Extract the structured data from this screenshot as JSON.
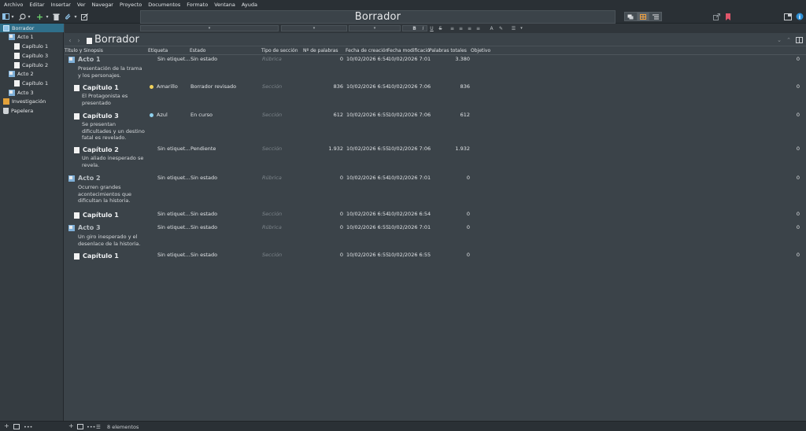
{
  "menu": [
    "Archivo",
    "Editar",
    "Insertar",
    "Ver",
    "Navegar",
    "Proyecto",
    "Documentos",
    "Formato",
    "Ventana",
    "Ayuda"
  ],
  "toolbar": {
    "title": "Borrador"
  },
  "binder": [
    {
      "label": "Borrador",
      "type": "draft",
      "level": 0,
      "selected": true
    },
    {
      "label": "Acto 1",
      "type": "folder",
      "level": 1
    },
    {
      "label": "Capítulo 1",
      "type": "doc",
      "level": 2
    },
    {
      "label": "Capítulo 3",
      "type": "doc",
      "level": 2
    },
    {
      "label": "Capítulo 2",
      "type": "doc",
      "level": 2
    },
    {
      "label": "Acto 2",
      "type": "folder",
      "level": 1
    },
    {
      "label": "Capítulo 1",
      "type": "doc",
      "level": 2
    },
    {
      "label": "Acto 3",
      "type": "folder",
      "level": 1
    },
    {
      "label": "Investigación",
      "type": "research",
      "level": 0
    },
    {
      "label": "Papelera",
      "type": "trash",
      "level": 0
    }
  ],
  "editor": {
    "doc_title": "Borrador"
  },
  "columns": {
    "title": "Título y Sinopsis",
    "label": "Etiqueta",
    "status": "Estado",
    "section": "Tipo de sección",
    "words": "Nº de palabras",
    "created": "Fecha de creación",
    "modified": "Fecha modificació",
    "total": "Palabras totales",
    "target": "Objetivo"
  },
  "rows": [
    {
      "title": "Acto 1",
      "synopsis": "Presentación de la trama y los personajes.",
      "kind": "folder",
      "label": "Sin etiquet...",
      "label_color": "",
      "status": "Sin estado",
      "section": "Rúbrica",
      "words": "0",
      "created": "10/02/2026 6:54",
      "modified": "10/02/2026 7:01",
      "total": "3.380",
      "target": "0"
    },
    {
      "title": "Capítulo 1",
      "synopsis": "El Protagonista es presentado",
      "kind": "doc",
      "label": "Amarillo",
      "label_color": "#f2d25c",
      "status": "Borrador revisado",
      "section": "Sección",
      "words": "836",
      "created": "10/02/2026 6:54",
      "modified": "10/02/2026 7:06",
      "total": "836",
      "target": "0"
    },
    {
      "title": "Capítulo 3",
      "synopsis": "Se presentan dificultades y un destino fatal es revelado.",
      "kind": "doc",
      "label": "Azul",
      "label_color": "#8fd1ee",
      "status": "En curso",
      "section": "Sección",
      "words": "612",
      "created": "10/02/2026 6:55",
      "modified": "10/02/2026 7:06",
      "total": "612",
      "target": "0"
    },
    {
      "title": "Capítulo 2",
      "synopsis": "Un aliado inesperado se revela.",
      "kind": "doc",
      "label": "Sin etiquet...",
      "label_color": "",
      "status": "Pendiente",
      "section": "Sección",
      "words": "1.932",
      "created": "10/02/2026 6:55",
      "modified": "10/02/2026 7:06",
      "total": "1.932",
      "target": "0"
    },
    {
      "title": "Acto 2",
      "synopsis": "Ocurren grandes acontecimientos que dificultan la historia.",
      "kind": "folder",
      "label": "Sin etiquet...",
      "label_color": "",
      "status": "Sin estado",
      "section": "Rúbrica",
      "words": "0",
      "created": "10/02/2026 6:54",
      "modified": "10/02/2026 7:01",
      "total": "0",
      "target": "0"
    },
    {
      "title": "Capítulo 1",
      "synopsis": "",
      "kind": "doc",
      "label": "Sin etiquet...",
      "label_color": "",
      "status": "Sin estado",
      "section": "Sección",
      "words": "0",
      "created": "10/02/2026 6:54",
      "modified": "10/02/2026 6:54",
      "total": "0",
      "target": "0"
    },
    {
      "title": "Acto 3",
      "synopsis": "Un giro inesperado y el desenlace de la historia.",
      "kind": "folder",
      "label": "Sin etiquet...",
      "label_color": "",
      "status": "Sin estado",
      "section": "Rúbrica",
      "words": "0",
      "created": "10/02/2026 6:55",
      "modified": "10/02/2026 7:01",
      "total": "0",
      "target": "0"
    },
    {
      "title": "Capítulo 1",
      "synopsis": "",
      "kind": "doc",
      "label": "Sin etiquet...",
      "label_color": "",
      "status": "Sin estado",
      "section": "Sección",
      "words": "0",
      "created": "10/02/2026 6:55",
      "modified": "10/02/2026 6:55",
      "total": "0",
      "target": "0"
    }
  ],
  "statusbar": {
    "count": "8 elementos"
  },
  "colors": {
    "accent": "#2f6f8a",
    "bg": "#3b4349",
    "bookmark": "#e0566a",
    "info": "#2d8fd5"
  }
}
